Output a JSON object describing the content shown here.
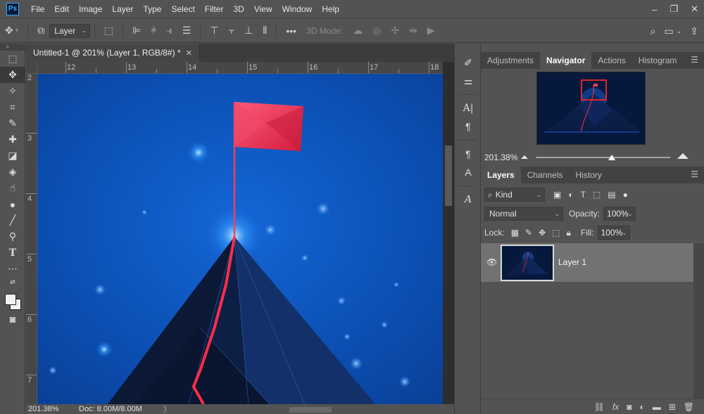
{
  "app": {
    "logo_text": "Ps"
  },
  "menu": [
    "File",
    "Edit",
    "Image",
    "Layer",
    "Type",
    "Select",
    "Filter",
    "3D",
    "View",
    "Window",
    "Help"
  ],
  "window_controls": {
    "minimize": "–",
    "restore": "❐",
    "close": "✕"
  },
  "options_bar": {
    "layer_select": "Layer",
    "more_label": "•••",
    "mode_label": "3D Mode:"
  },
  "document": {
    "tab_title": "Untitled-1 @ 201% (Layer 1, RGB/8#) *",
    "ruler_h": [
      "12",
      "13",
      "14",
      "15",
      "16",
      "17",
      "18"
    ],
    "ruler_v": [
      "2",
      "3",
      "4",
      "5",
      "6",
      "7"
    ],
    "status_zoom": "201.38%",
    "status_doc": "Doc: 8.00M/8.00M",
    "status_arrow": "〉"
  },
  "panels": {
    "top_tabs": [
      "Adjustments",
      "Navigator",
      "Actions",
      "Histogram"
    ],
    "active_top_tab": "Navigator",
    "navigator_zoom": "201.38%",
    "bottom_tabs": [
      "Layers",
      "Channels",
      "History"
    ],
    "active_bottom_tab": "Layers",
    "kind_filter": "Kind",
    "blend_mode": "Normal",
    "opacity_label": "Opacity:",
    "opacity_value": "100%",
    "lock_label": "Lock:",
    "fill_label": "Fill:",
    "fill_value": "100%",
    "layers": [
      {
        "name": "Layer 1",
        "visible": true
      }
    ]
  },
  "colors": {
    "canvas_blue": "#0a4aa8",
    "flag_red": "#e83250",
    "foreground": "#f2f2f2",
    "background": "#f2f2f2"
  }
}
